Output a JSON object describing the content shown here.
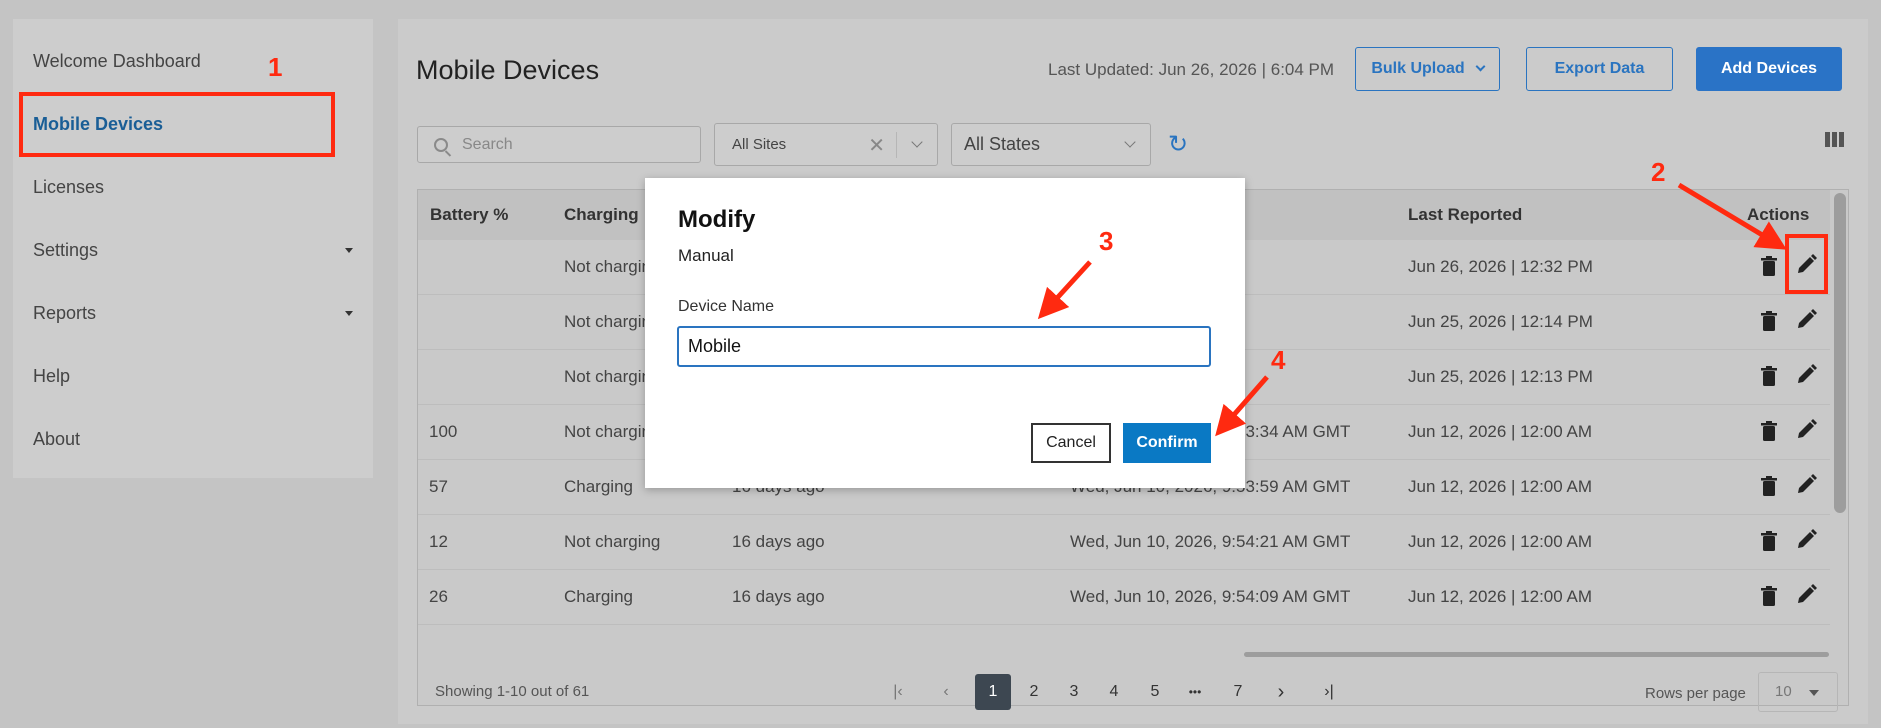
{
  "sidebar": {
    "items": [
      {
        "label": "Welcome Dashboard",
        "active": false,
        "has_submenu": false
      },
      {
        "label": "Mobile Devices",
        "active": true,
        "has_submenu": false
      },
      {
        "label": "Licenses",
        "active": false,
        "has_submenu": false
      },
      {
        "label": "Settings",
        "active": false,
        "has_submenu": true
      },
      {
        "label": "Reports",
        "active": false,
        "has_submenu": true
      },
      {
        "label": "Help",
        "active": false,
        "has_submenu": false
      },
      {
        "label": "About",
        "active": false,
        "has_submenu": false
      }
    ]
  },
  "header": {
    "title": "Mobile Devices",
    "last_updated": "Last Updated: Jun 26, 2026 | 6:04 PM",
    "bulk_upload": "Bulk Upload",
    "export_data": "Export Data",
    "add_devices": "Add Devices"
  },
  "filters": {
    "search_placeholder": "Search",
    "sites_value": "All Sites",
    "states_value": "All States"
  },
  "table": {
    "headers": {
      "battery": "Battery %",
      "charging": "Charging",
      "last_reported": "Last Reported",
      "actions": "Actions"
    },
    "rows": [
      {
        "battery": "",
        "charging": "Not charging",
        "seen": "",
        "time": "",
        "reported": "Jun 26, 2026 | 12:32 PM"
      },
      {
        "battery": "",
        "charging": "Not charging",
        "seen": "",
        "time": "",
        "reported": "Jun 25, 2026 | 12:14 PM"
      },
      {
        "battery": "",
        "charging": "Not charging",
        "seen": "",
        "time": "",
        "reported": "Jun 25, 2026 | 12:13 PM"
      },
      {
        "battery": "100",
        "charging": "Not charging",
        "seen": "",
        "time": "Wed, Jun 10, 2026, 9:53:34 AM GMT",
        "reported": "Jun 12, 2026 | 12:00 AM"
      },
      {
        "battery": "57",
        "charging": "Charging",
        "seen": "16 days ago",
        "time": "Wed, Jun 10, 2026, 9:53:59 AM GMT",
        "reported": "Jun 12, 2026 | 12:00 AM"
      },
      {
        "battery": "12",
        "charging": "Not charging",
        "seen": "16 days ago",
        "time": "Wed, Jun 10, 2026, 9:54:21 AM GMT",
        "reported": "Jun 12, 2026 | 12:00 AM"
      },
      {
        "battery": "26",
        "charging": "Charging",
        "seen": "16 days ago",
        "time": "Wed, Jun 10, 2026, 9:54:09 AM GMT",
        "reported": "Jun 12, 2026 | 12:00 AM"
      }
    ]
  },
  "pagination": {
    "showing": "Showing 1-10 out of 61",
    "first": "|‹",
    "prev": "‹",
    "pages": [
      "1",
      "2",
      "3",
      "4",
      "5",
      "•••",
      "7"
    ],
    "next": "›",
    "last": "›|",
    "rows_per_page_label": "Rows per page",
    "rows_per_page_value": "10"
  },
  "modal": {
    "title": "Modify",
    "subtitle": "Manual",
    "field_label": "Device Name",
    "field_value": "Mobile",
    "cancel": "Cancel",
    "confirm": "Confirm"
  },
  "annotations": {
    "n1": "1",
    "n2": "2",
    "n3": "3",
    "n4": "4"
  },
  "colors": {
    "accent": "#2a74c0",
    "annotation": "#ff2a10",
    "confirm": "#0a79c4"
  }
}
